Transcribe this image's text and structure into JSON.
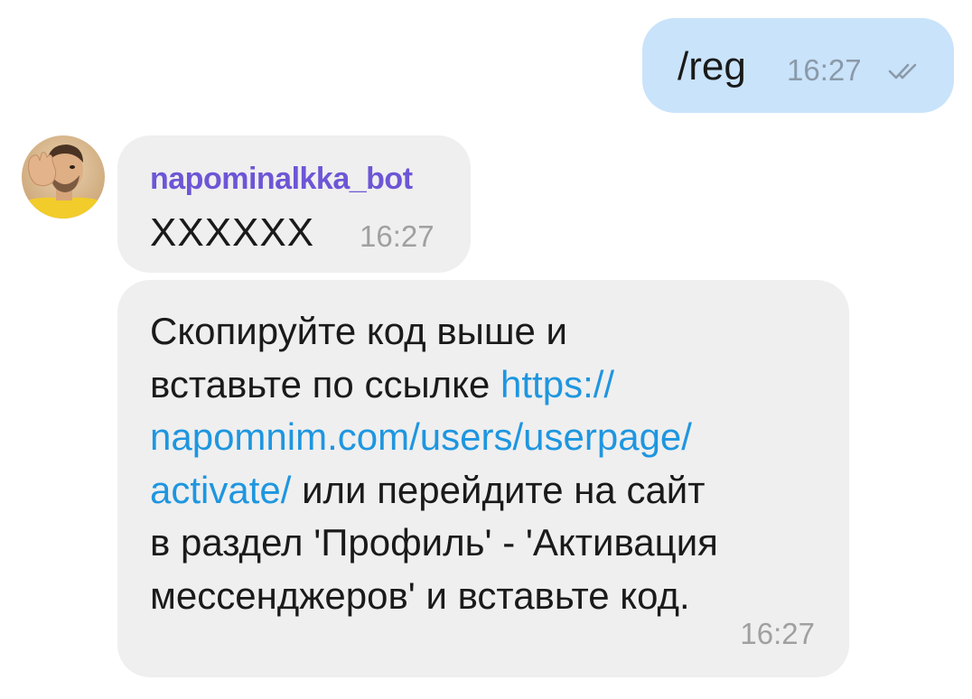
{
  "outgoing": {
    "text": "/reg",
    "time": "16:27",
    "status_icon": "double-check-icon"
  },
  "incoming": [
    {
      "sender": "napominalkka_bot",
      "text": "XXXXXX",
      "time": "16:27"
    },
    {
      "line1": "Скопируйте код выше и",
      "line2_text": "вставьте по ссылке ",
      "line2_link": "https://",
      "line3_link": "napomnim.com/users/userpage/",
      "line4_link": "activate/",
      "line4_text": " или перейдите на сайт",
      "line5": "в раздел 'Профиль' - 'Активация",
      "line6": "мессенджеров' и вставьте код.",
      "time": "16:27"
    }
  ],
  "colors": {
    "outgoing_bubble": "#c9e3fb",
    "incoming_bubble": "#efefef",
    "sender_name": "#6d56d6",
    "link": "#1e96e0"
  }
}
